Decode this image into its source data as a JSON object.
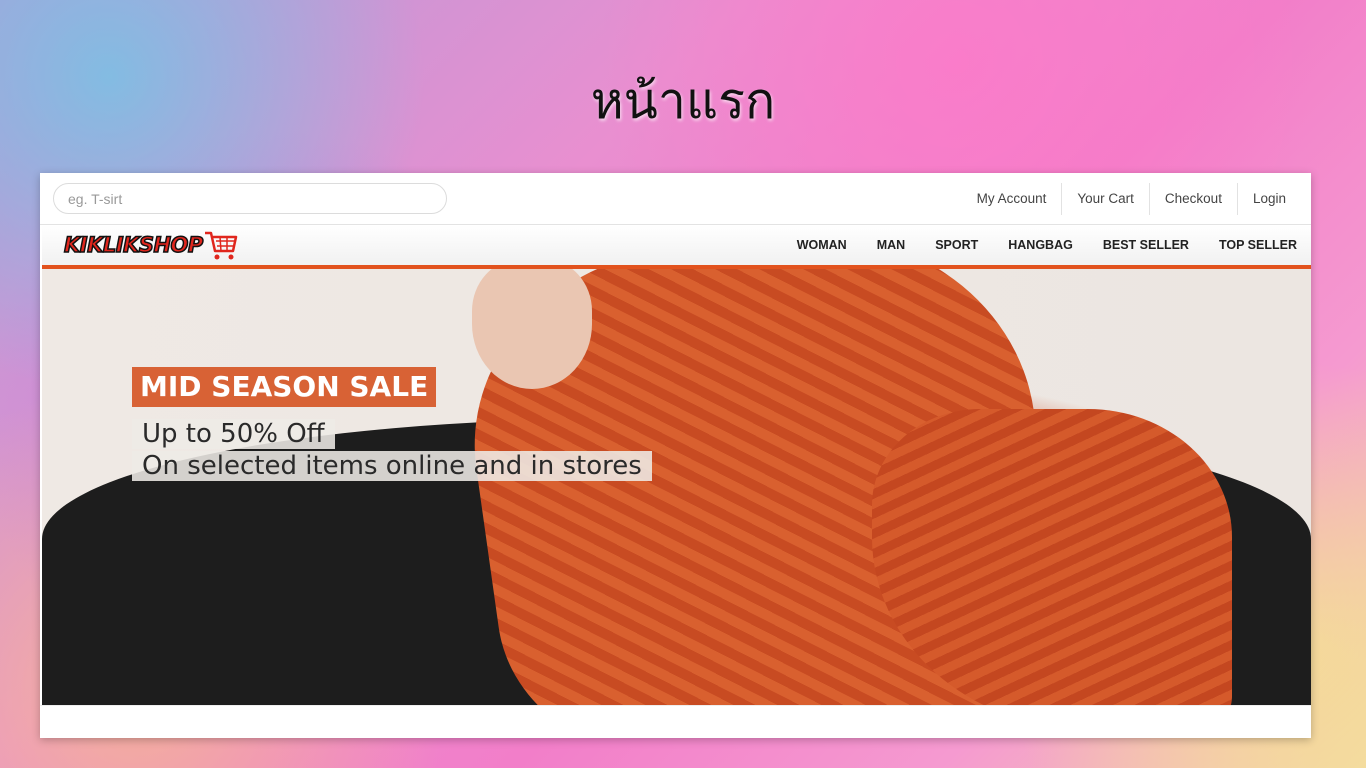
{
  "slide": {
    "title": "หน้าแรก"
  },
  "search": {
    "placeholder": "eg. T-sirt"
  },
  "user_links": [
    "My Account",
    "Your Cart",
    "Checkout",
    "Login"
  ],
  "logo": {
    "text": "KIKLIKSHOP",
    "icon": "shopping-cart-icon"
  },
  "nav": [
    "WOMAN",
    "MAN",
    "SPORT",
    "HANGBAG",
    "BEST SELLER",
    "TOP SELLER"
  ],
  "hero": {
    "tag": "MID SEASON SALE",
    "line1": "Up to 50% Off",
    "line2": "On selected items online and in stores"
  },
  "colors": {
    "accent": "#e2521d",
    "logo_red": "#e0261d"
  }
}
